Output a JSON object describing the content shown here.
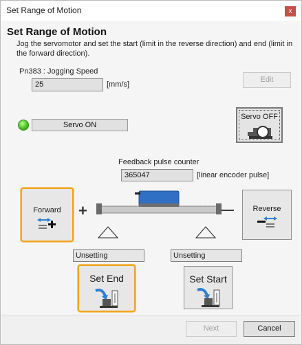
{
  "window": {
    "title": "Set Range of Motion",
    "close_glyph": "x"
  },
  "header": {
    "title": "Set Range of Motion",
    "description": "Jog the servomotor and set the start (limit in the reverse direction) and end (limit in the forward direction)."
  },
  "jog": {
    "label": "Pn383 : Jogging Speed",
    "value": "25",
    "unit": "[mm/s]",
    "edit_label": "Edit"
  },
  "servo": {
    "on_label": "Servo ON",
    "off_label": "Servo OFF",
    "led_color": "#46c21e"
  },
  "feedback": {
    "label": "Feedback pulse counter",
    "value": "365047",
    "unit": "[linear encoder pulse]"
  },
  "motion": {
    "forward_label": "Forward",
    "reverse_label": "Reverse",
    "plus_sign": "+",
    "minus_sign": "—"
  },
  "limits": {
    "end_status": "Unsetting",
    "start_status": "Unsetting",
    "set_end_label": "Set End",
    "set_start_label": "Set Start"
  },
  "footer": {
    "next_label": "Next",
    "cancel_label": "Cancel"
  },
  "colors": {
    "highlight": "#f0a421",
    "slider_blue": "#2f6fc4",
    "arrow_blue": "#2f7fd6"
  }
}
